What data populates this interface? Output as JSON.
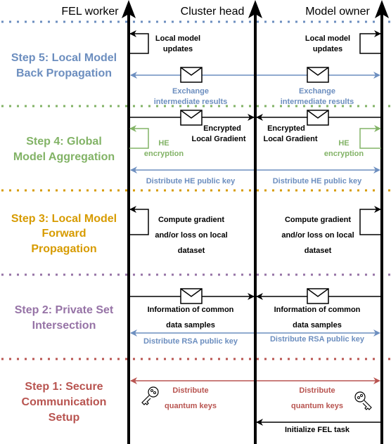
{
  "colors": {
    "step5": "#6c8ebf",
    "step4": "#82b366",
    "step3": "#d79b00",
    "step2": "#9673a6",
    "step1": "#b85450",
    "message": "#000000"
  },
  "lifelines": [
    "FEL worker",
    "Cluster head",
    "Model owner"
  ],
  "steps": [
    {
      "lines": [
        "Step 5: Local Model",
        "Back Propagation"
      ]
    },
    {
      "lines": [
        "Step 4: Global",
        "Model Aggregation"
      ]
    },
    {
      "lines": [
        "Step 3: Local Model",
        "Forward",
        "Propagation"
      ]
    },
    {
      "lines": [
        "Step 2: Private Set",
        "Intersection"
      ]
    },
    {
      "lines": [
        "Step 1: Secure",
        "Communication",
        "Setup"
      ]
    }
  ],
  "messages": {
    "local_updates": [
      "Local model",
      "updates"
    ],
    "exchange": [
      "Exchange",
      "intermediate results"
    ],
    "encrypted": [
      "Encrypted",
      "Local Gradient"
    ],
    "he": [
      "HE",
      "encryption"
    ],
    "he_key": "Distribute HE public key",
    "compute": [
      "Compute gradient",
      "and/or loss on local",
      "dataset"
    ],
    "info": [
      "Information of common",
      "data samples"
    ],
    "rsa_key": "Distribute RSA public key",
    "quantum": [
      "Distribute",
      "quantum keys"
    ],
    "init": "Initialize FEL task"
  },
  "icons": [
    "envelope-icon",
    "key-icon"
  ]
}
